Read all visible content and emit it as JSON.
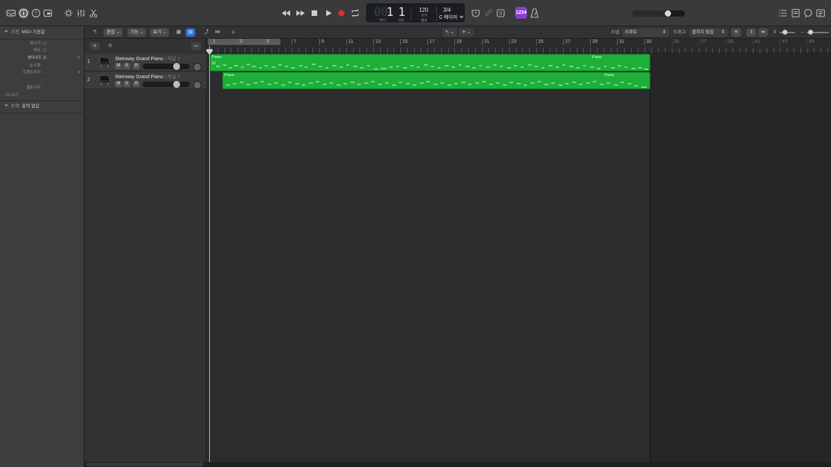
{
  "transport": {
    "lcd": {
      "bar_dim": "00",
      "bar": "1",
      "beat": "1",
      "bar_label": "마디",
      "beat_label": "비트",
      "tempo": "120",
      "tempo_label": "유지",
      "tempo_sub": "템포",
      "signature": "3/4",
      "key": "C 메이저"
    },
    "count_in": "1234"
  },
  "inspector": {
    "region_prefix": "리전:",
    "region_title": "MIDI 기본값",
    "rows": [
      {
        "k": "음소거:",
        "v": ""
      },
      {
        "k": "루프:",
        "v": ""
      },
      {
        "k": "퀀타이즈",
        "v": "끔"
      },
      {
        "k": "Q-스윙:",
        "v": ""
      },
      {
        "k": "트랜스포즈:",
        "v": ""
      },
      {
        "k": "벨로시티:",
        "v": ""
      }
    ],
    "more_label": "더 보기",
    "track_prefix": "트랙:",
    "track_title": "출력 없음"
  },
  "track_toolbar": {
    "edit": "편집",
    "functions": "기능",
    "view": "보기",
    "snap_label": "스냅:",
    "snap_value": "스마트",
    "drag_label": "드래그:",
    "drag_value": "겹치지 않음"
  },
  "tracks": [
    {
      "num": "1",
      "name": "Steinway Grand Piano",
      "channel": "채널 1",
      "m": "M",
      "s": "S",
      "r": "R"
    },
    {
      "num": "2",
      "name": "Steinway Grand Piano",
      "channel": "채널 1",
      "m": "M",
      "s": "S",
      "r": "R"
    }
  ],
  "ruler_bars": [
    "1",
    "3",
    "5",
    "7",
    "9",
    "11",
    "13",
    "15",
    "17",
    "19",
    "21",
    "23",
    "25",
    "27",
    "29",
    "31",
    "33",
    "35",
    "37",
    "39",
    "41",
    "43",
    "45"
  ],
  "regions": [
    {
      "name_start": "Piano",
      "name_end": "Piano",
      "loop_marker": "02"
    },
    {
      "name_start": "Piano",
      "name_end": "Piano"
    }
  ],
  "colors": {
    "region_green": "#1fae3a",
    "count_in_purple": "#8b3fd4",
    "active_blue": "#2f6fd6",
    "record_red": "#e0282e"
  }
}
